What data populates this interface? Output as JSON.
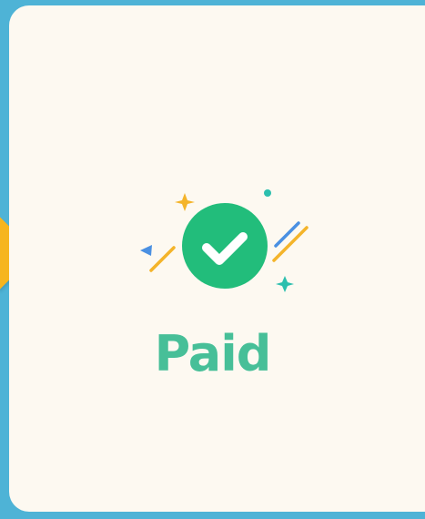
{
  "status": {
    "label": "Paid",
    "icon": "check-circle-icon"
  },
  "colors": {
    "background": "#4eb3d6",
    "card": "#fdf9f1",
    "accent_green": "#22bd7b",
    "label_green": "#47bf98",
    "marker_yellow": "#f6b51e",
    "confetti_yellow": "#f4b42a",
    "confetti_blue": "#4a90e2",
    "confetti_teal": "#2cbfae"
  }
}
